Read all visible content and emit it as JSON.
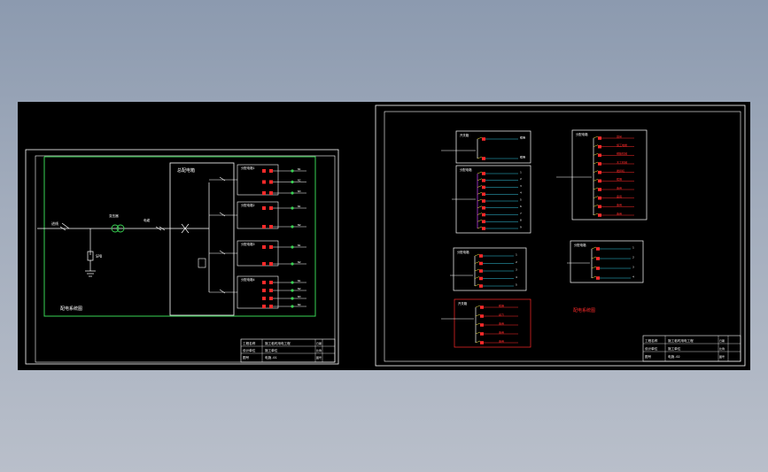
{
  "drawing": {
    "left_sheet": {
      "system_title": "配电系统图",
      "main_panel_label": "总配电箱",
      "incoming_label": "进线",
      "surge_label": "SPD",
      "transformer_label": "变压器",
      "cable_label": "电缆",
      "feeders": [
        {
          "name": "分配电箱1",
          "outputs": [
            "N1",
            "N2",
            "N3"
          ]
        },
        {
          "name": "分配电箱2",
          "outputs": [
            "N1",
            "N2"
          ]
        },
        {
          "name": "分配电箱3",
          "outputs": [
            "N1",
            "N2"
          ]
        },
        {
          "name": "分配电箱4",
          "outputs": [
            "N1",
            "N2",
            "N3",
            "N4"
          ]
        }
      ],
      "title_block": {
        "rows": [
          "工程名称",
          "设计单位",
          "图号"
        ],
        "values": [
          "施工临时用电工程",
          "施工单位",
          "电施-01"
        ],
        "right_cells": [
          "日期",
          "比例",
          "图号"
        ]
      }
    },
    "right_sheet": {
      "system_title": "配电系统图",
      "boxes": [
        {
          "name": "开关箱",
          "outputs": [
            "照明",
            "照明"
          ]
        },
        {
          "name": "分配电箱",
          "outputs": [
            "1",
            "2",
            "3",
            "4",
            "5",
            "6",
            "7",
            "8",
            "9"
          ]
        },
        {
          "name": "分配电箱",
          "outputs": [
            "塔吊",
            "施工电梯",
            "钢筋机械",
            "木工机械",
            "搅拌机",
            "照明",
            "备用",
            "备用",
            "备用",
            "备用"
          ]
        },
        {
          "name": "分配电箱",
          "outputs": [
            "1",
            "2",
            "3",
            "4",
            "5"
          ]
        },
        {
          "name": "分配电箱",
          "outputs": [
            "1",
            "2",
            "3",
            "4"
          ]
        },
        {
          "name": "开关箱",
          "outputs": [
            "照明",
            "动力",
            "备用",
            "备用",
            "备用"
          ]
        }
      ],
      "title_block": {
        "rows": [
          "工程名称",
          "设计单位",
          "图号"
        ],
        "values": [
          "施工临时用电工程",
          "施工单位",
          "电施-02"
        ],
        "right_cells": [
          "日期",
          "比例",
          "图号"
        ]
      }
    },
    "colors": {
      "canvas": "#000000",
      "frame": "#ffffff",
      "wire": "#ffffff",
      "bus": "#39d353",
      "breaker": "#ff2a2a",
      "cyan": "#33c6e0",
      "magenta": "#d040ff",
      "yellow": "#f5e642"
    }
  }
}
